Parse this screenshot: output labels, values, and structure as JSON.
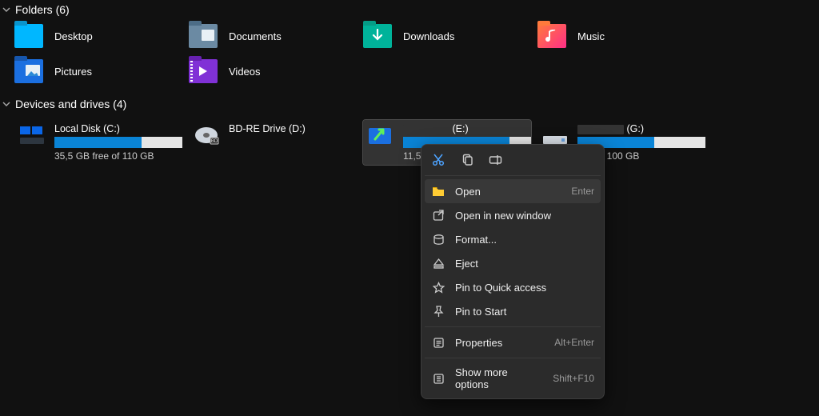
{
  "folders": {
    "header": "Folders (6)",
    "items": [
      {
        "label": "Desktop"
      },
      {
        "label": "Documents"
      },
      {
        "label": "Downloads"
      },
      {
        "label": "Music"
      },
      {
        "label": "Pictures"
      },
      {
        "label": "Videos"
      }
    ]
  },
  "drives": {
    "header": "Devices and drives (4)",
    "items": [
      {
        "name": "Local Disk (C:)",
        "percent_used": 68,
        "free_text": "35,5 GB free of 110 GB"
      },
      {
        "name": "BD-RE Drive (D:)"
      },
      {
        "name_suffix": "(E:)",
        "percent_used": 83,
        "free_prefix": "11,5 GB"
      },
      {
        "name_suffix": "(G:)",
        "percent_used": 60,
        "free_suffix": "of 100 GB"
      }
    ]
  },
  "context_menu": {
    "open": "Open",
    "open_shortcut": "Enter",
    "open_new_window": "Open in new window",
    "format": "Format...",
    "eject": "Eject",
    "pin_quick": "Pin to Quick access",
    "pin_start": "Pin to Start",
    "properties": "Properties",
    "properties_shortcut": "Alt+Enter",
    "show_more": "Show more options",
    "show_more_shortcut": "Shift+F10"
  }
}
